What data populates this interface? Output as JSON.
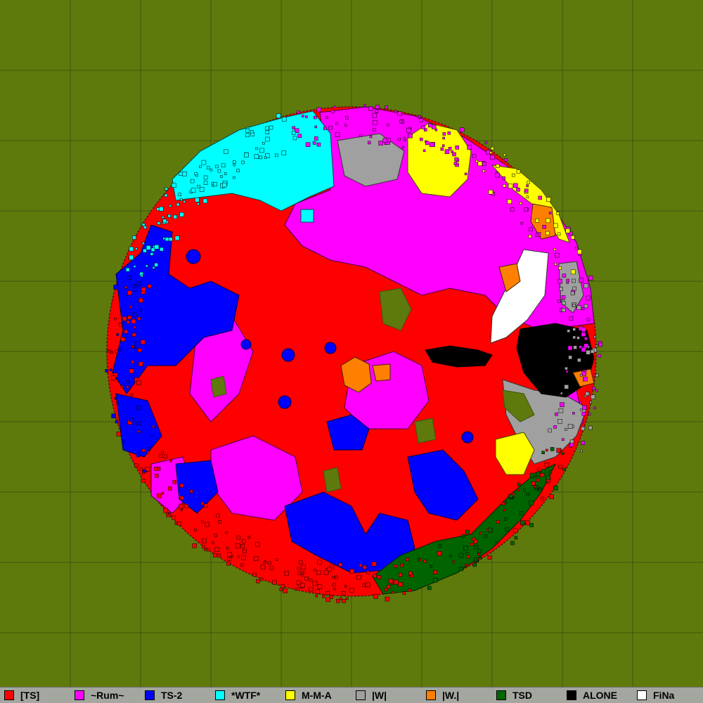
{
  "map": {
    "background_color": "#5f7a0c",
    "grid_color": "#3e5510",
    "grid_lines": "on"
  },
  "legend": {
    "background_color": "#a4a6a0",
    "entries": [
      {
        "label": "[TS]",
        "color": "#ff0000"
      },
      {
        "label": "~Rum~",
        "color": "#ff00ff"
      },
      {
        "label": "TS-2",
        "color": "#0000ff"
      },
      {
        "label": "*WTF*",
        "color": "#00ffff"
      },
      {
        "label": "M-M-A",
        "color": "#ffff00"
      },
      {
        "label": "|W|",
        "color": "#a0a0a0"
      },
      {
        "label": "|W.|",
        "color": "#ff8000"
      },
      {
        "label": "TSD",
        "color": "#006400"
      },
      {
        "label": "ALONE",
        "color": "#000000"
      },
      {
        "label": "FiNa",
        "color": "#ffffff"
      }
    ]
  }
}
